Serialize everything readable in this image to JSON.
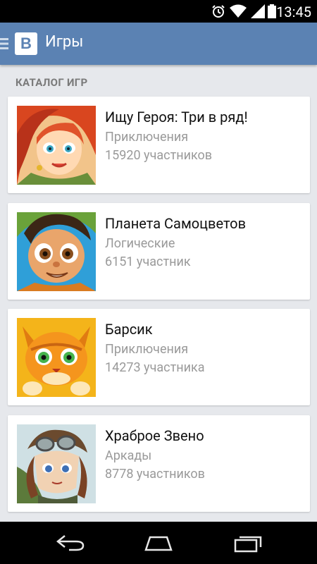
{
  "status_bar": {
    "time": "13:45",
    "icons": [
      "alarm-icon",
      "wifi-icon",
      "signal-icon",
      "battery-icon"
    ]
  },
  "app_bar": {
    "logo": "В",
    "title": "Игры",
    "color": "#5b82b3"
  },
  "section": {
    "title": "КАТАЛОГ ИГР"
  },
  "games": [
    {
      "title": "Ищу Героя: Три в ряд!",
      "genre": "Приключения",
      "players": "15920 участников",
      "thumb": "red-haired-heroine-portrait"
    },
    {
      "title": "Планета Самоцветов",
      "genre": "Логические",
      "players": "6151 участник",
      "thumb": "cartoon-boy-portrait"
    },
    {
      "title": "Барсик",
      "genre": "Приключения",
      "players": "14273 участника",
      "thumb": "orange-cartoon-cat"
    },
    {
      "title": "Храброе Звено",
      "genre": "Аркады",
      "players": "8778 участников",
      "thumb": "pilot-girl-portrait"
    }
  ],
  "nav_bar": {
    "icons": [
      "back-icon",
      "home-icon",
      "recents-icon"
    ]
  }
}
